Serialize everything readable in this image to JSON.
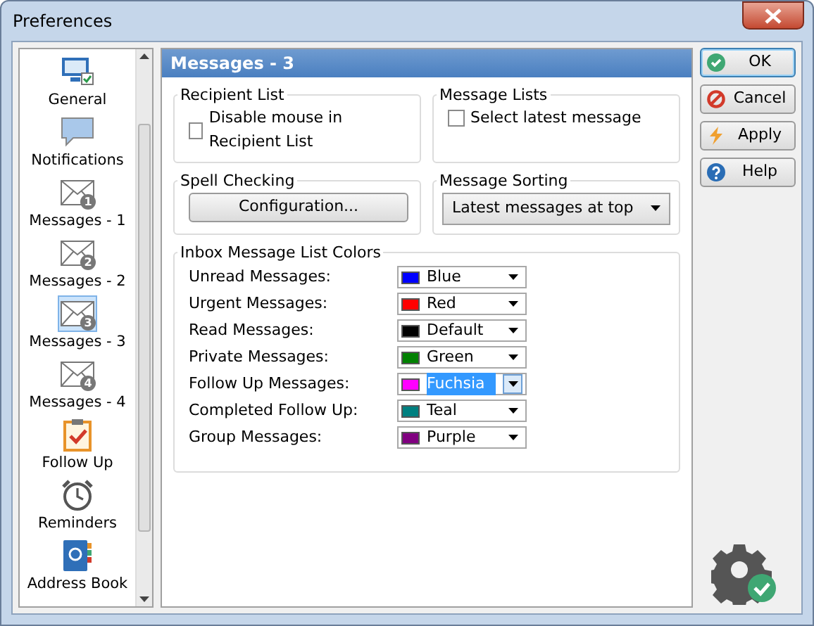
{
  "window": {
    "title": "Preferences"
  },
  "sidebar": {
    "items": [
      {
        "kind": "monitor",
        "label": "General",
        "selected": false
      },
      {
        "kind": "bubble",
        "label": "Notifications",
        "selected": false
      },
      {
        "kind": "envelope",
        "badge": "1",
        "label": "Messages - 1",
        "selected": false
      },
      {
        "kind": "envelope",
        "badge": "2",
        "label": "Messages - 2",
        "selected": false
      },
      {
        "kind": "envelope",
        "badge": "3",
        "label": "Messages - 3",
        "selected": true
      },
      {
        "kind": "envelope",
        "badge": "4",
        "label": "Messages - 4",
        "selected": false
      },
      {
        "kind": "clipboard",
        "label": "Follow Up",
        "selected": false
      },
      {
        "kind": "clock",
        "label": "Reminders",
        "selected": false
      },
      {
        "kind": "book",
        "label": "Address Book",
        "selected": false
      }
    ]
  },
  "panel": {
    "title": "Messages - 3",
    "recipient_list": {
      "title": "Recipient List",
      "checkbox": {
        "label": "Disable mouse in Recipient List",
        "checked": false
      }
    },
    "message_lists": {
      "title": "Message Lists",
      "checkbox": {
        "label": "Select latest message",
        "checked": false
      }
    },
    "spell_checking": {
      "title": "Spell Checking",
      "button": "Configuration..."
    },
    "message_sorting": {
      "title": "Message Sorting",
      "value": "Latest messages at top"
    },
    "colors": {
      "title": "Inbox Message List Colors",
      "rows": [
        {
          "label": "Unread Messages:",
          "value": "Blue",
          "color": "#0000ff",
          "selected": false
        },
        {
          "label": "Urgent Messages:",
          "value": "Red",
          "color": "#ff0000",
          "selected": false
        },
        {
          "label": "Read Messages:",
          "value": "Default",
          "color": "#000000",
          "selected": false
        },
        {
          "label": "Private Messages:",
          "value": "Green",
          "color": "#008000",
          "selected": false
        },
        {
          "label": "Follow Up Messages:",
          "value": "Fuchsia",
          "color": "#ff00ff",
          "selected": true
        },
        {
          "label": "Completed Follow Up:",
          "value": "Teal",
          "color": "#008080",
          "selected": false
        },
        {
          "label": "Group Messages:",
          "value": "Purple",
          "color": "#800080",
          "selected": false
        }
      ]
    }
  },
  "buttons": [
    {
      "kind": "ok",
      "label": "OK",
      "focused": true
    },
    {
      "kind": "cancel",
      "label": "Cancel",
      "focused": false
    },
    {
      "kind": "apply",
      "label": "Apply",
      "focused": false
    },
    {
      "kind": "help",
      "label": "Help",
      "focused": false
    }
  ]
}
